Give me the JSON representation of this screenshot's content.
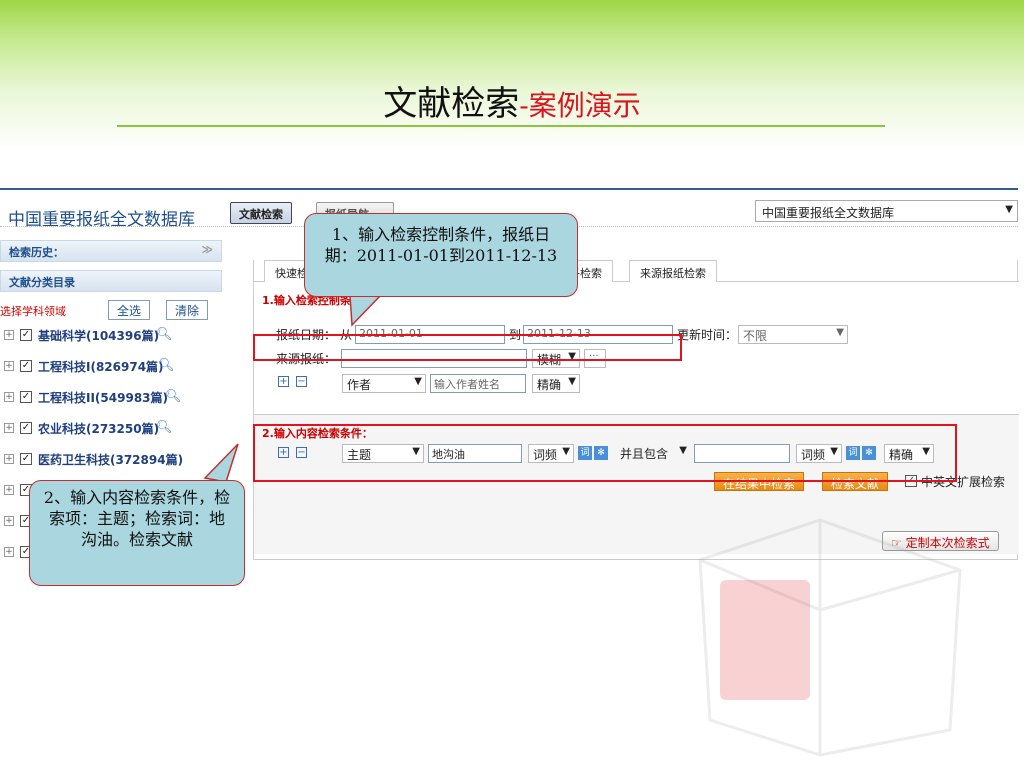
{
  "slide": {
    "title": "文献检索",
    "subtitle": "-案例演示"
  },
  "app": {
    "db_title": "中国重要报纸全文数据库",
    "tabs": [
      "文献检索",
      "报纸导航"
    ],
    "db_select": "中国重要报纸全文数据库"
  },
  "sidebar": {
    "history_label": "检索历史：",
    "catalog_label": "文献分类目录",
    "subject_label": "选择学科领域",
    "select_all": "全选",
    "clear": "清除",
    "categories": [
      "基础科学(104396篇)",
      "工程科技I(826974篇)",
      "工程科技II(549983篇)",
      "农业科技(273250篇)",
      "医药卫生科技(372894篇)"
    ]
  },
  "main": {
    "tabs": [
      "快速检",
      "子检索",
      "来源报纸检索"
    ],
    "section1": "1.输入检索控制条件：",
    "date_label": "报纸日期：",
    "from": "从",
    "date_from": "2011-01-01",
    "to": "到",
    "date_to": "2011-12-13",
    "update_label": "更新时间：",
    "update_value": "不限",
    "source_label": "来源报纸：",
    "fuzzy": "模糊",
    "author_field": "作者",
    "author_placeholder": "输入作者姓名",
    "exact": "精确",
    "section2": "2.输入内容检索条件：",
    "field_subject": "主题",
    "keyword": "地沟油",
    "freq": "词频",
    "and_include": "并且包含",
    "exact2": "精确",
    "search_in_results": "在结果中检索",
    "search_docs": "检索文献",
    "expand": "中英文扩展检索",
    "custom": "定制本次检索式"
  },
  "callouts": {
    "one": "1、输入检索控制条件，报纸日期：2011-01-01到2011-12-13",
    "two": "2、输入内容检索条件，检索项：主题；检索词：地沟油。检索文献"
  }
}
